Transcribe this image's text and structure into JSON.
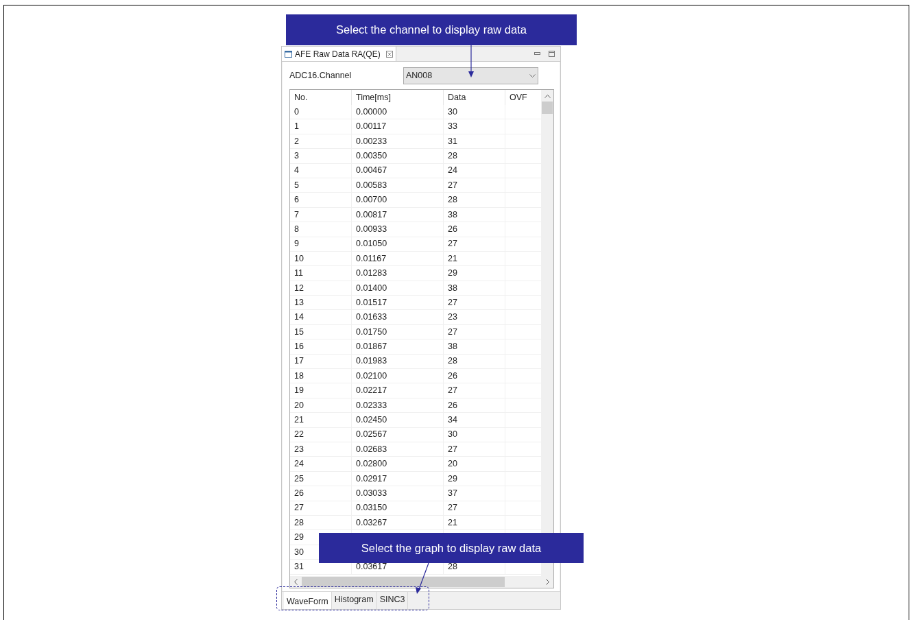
{
  "callouts": [
    {
      "text": "Select the channel to display raw data"
    },
    {
      "text": "Select the graph to display raw data"
    }
  ],
  "view": {
    "title": "AFE Raw Data RA(QE)"
  },
  "channel": {
    "label": "ADC16.Channel",
    "value": "AN008"
  },
  "table": {
    "columns": [
      "No.",
      "Time[ms]",
      "Data",
      "OVF"
    ],
    "rows": [
      {
        "no": "0",
        "time": "0.00000",
        "data": "30"
      },
      {
        "no": "1",
        "time": "0.00117",
        "data": "33"
      },
      {
        "no": "2",
        "time": "0.00233",
        "data": "31"
      },
      {
        "no": "3",
        "time": "0.00350",
        "data": "28"
      },
      {
        "no": "4",
        "time": "0.00467",
        "data": "24"
      },
      {
        "no": "5",
        "time": "0.00583",
        "data": "27"
      },
      {
        "no": "6",
        "time": "0.00700",
        "data": "28"
      },
      {
        "no": "7",
        "time": "0.00817",
        "data": "38"
      },
      {
        "no": "8",
        "time": "0.00933",
        "data": "26"
      },
      {
        "no": "9",
        "time": "0.01050",
        "data": "27"
      },
      {
        "no": "10",
        "time": "0.01167",
        "data": "21"
      },
      {
        "no": "11",
        "time": "0.01283",
        "data": "29"
      },
      {
        "no": "12",
        "time": "0.01400",
        "data": "38"
      },
      {
        "no": "13",
        "time": "0.01517",
        "data": "27"
      },
      {
        "no": "14",
        "time": "0.01633",
        "data": "23"
      },
      {
        "no": "15",
        "time": "0.01750",
        "data": "27"
      },
      {
        "no": "16",
        "time": "0.01867",
        "data": "38"
      },
      {
        "no": "17",
        "time": "0.01983",
        "data": "28"
      },
      {
        "no": "18",
        "time": "0.02100",
        "data": "26"
      },
      {
        "no": "19",
        "time": "0.02217",
        "data": "27"
      },
      {
        "no": "20",
        "time": "0.02333",
        "data": "26"
      },
      {
        "no": "21",
        "time": "0.02450",
        "data": "34"
      },
      {
        "no": "22",
        "time": "0.02567",
        "data": "30"
      },
      {
        "no": "23",
        "time": "0.02683",
        "data": "27"
      },
      {
        "no": "24",
        "time": "0.02800",
        "data": "20"
      },
      {
        "no": "25",
        "time": "0.02917",
        "data": "29"
      },
      {
        "no": "26",
        "time": "0.03033",
        "data": "37"
      },
      {
        "no": "27",
        "time": "0.03150",
        "data": "27"
      },
      {
        "no": "28",
        "time": "0.03267",
        "data": "21"
      },
      {
        "no": "29"
      },
      {
        "no": "30"
      },
      {
        "no": "31",
        "time": "0.03617",
        "data": "28"
      }
    ]
  },
  "graph_tabs": [
    {
      "label": "WaveForm",
      "selected": true
    },
    {
      "label": "Histogram",
      "selected": false
    },
    {
      "label": "SINC3",
      "selected": false
    }
  ]
}
